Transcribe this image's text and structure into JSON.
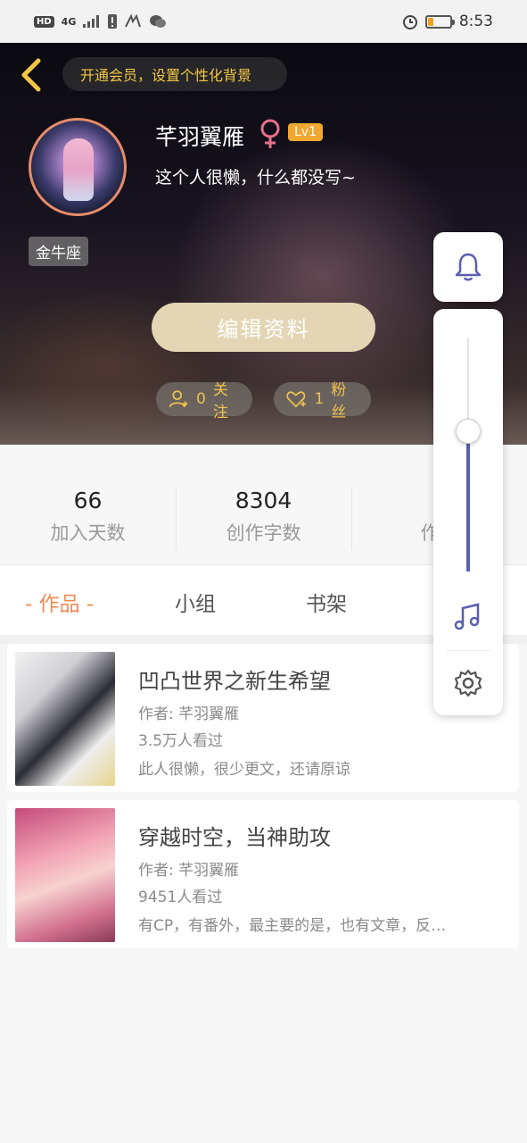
{
  "status_bar": {
    "hd": "HD",
    "network": "4G",
    "time": "8:53",
    "battery_level": 0.25
  },
  "header": {
    "vip_banner": "开通会员，设置个性化背景",
    "username": "芊羽翼雁",
    "gender_symbol": "♀",
    "level": "Lv1",
    "bio": "这个人很懒，什么都没写~",
    "zodiac": "金牛座",
    "edit_button": "编辑资料",
    "follow": {
      "count": "0",
      "label": "关注"
    },
    "fans": {
      "count": "1",
      "label": "粉丝"
    }
  },
  "stats": [
    {
      "value": "66",
      "label": "加入天数"
    },
    {
      "value": "8304",
      "label": "创作字数"
    },
    {
      "value": "",
      "label": "作品"
    }
  ],
  "tabs": [
    {
      "label": "- 作品 -",
      "active": true
    },
    {
      "label": "小组",
      "active": false
    },
    {
      "label": "书架",
      "active": false
    }
  ],
  "works": [
    {
      "title": "凹凸世界之新生希望",
      "author": "作者: 芊羽翼雁",
      "views": "3.5万人看过",
      "description": "此人很懒，很少更文，还请原谅"
    },
    {
      "title": "穿越时空，当神助攻",
      "author": "作者: 芊羽翼雁",
      "views": "9451人看过",
      "description": "有CP，有番外，最主要的是，也有文章，反…"
    }
  ],
  "floating_panel": {
    "volume_level": 0.6,
    "icons": [
      "bell-icon",
      "music-icon",
      "gear-icon"
    ]
  },
  "colors": {
    "accent_orange": "#f08b55",
    "gold": "#f2c744",
    "slider_blue": "#5a5fae"
  }
}
